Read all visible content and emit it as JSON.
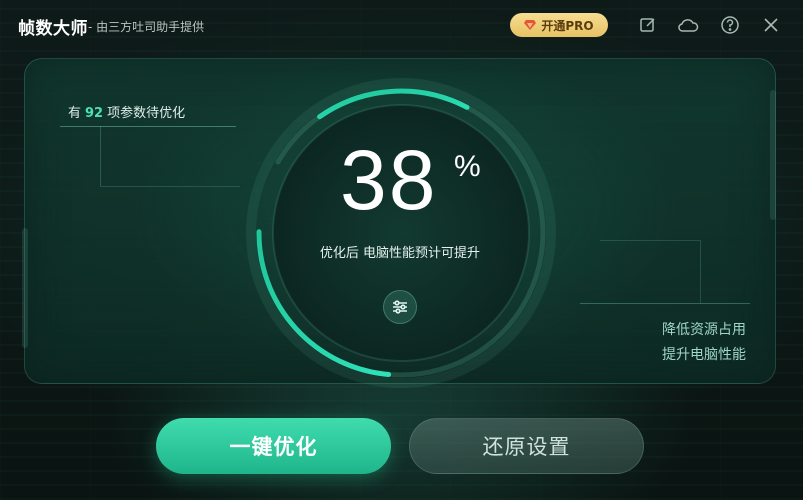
{
  "titlebar": {
    "app_name": "帧数大师",
    "subtitle": "- 由三方吐司助手提供",
    "pro_label": "开通PRO",
    "icons": [
      "edit-icon",
      "cloud-icon",
      "help-icon",
      "close-icon"
    ]
  },
  "panel": {
    "params_prefix": "有",
    "params_count": "92",
    "params_suffix": "项参数待优化",
    "percent_value": "38",
    "percent_sign": "%",
    "progress_fraction": 0.38,
    "caption": "优化后 电脑性能预计可提升",
    "note_line1": "降低资源占用",
    "note_line2": "提升电脑性能"
  },
  "actions": {
    "primary_label": "一键优化",
    "secondary_label": "还原设置"
  },
  "colors": {
    "accent": "#3fdcae",
    "pro_gold": "#e7c263",
    "background": "#0d1a17"
  }
}
